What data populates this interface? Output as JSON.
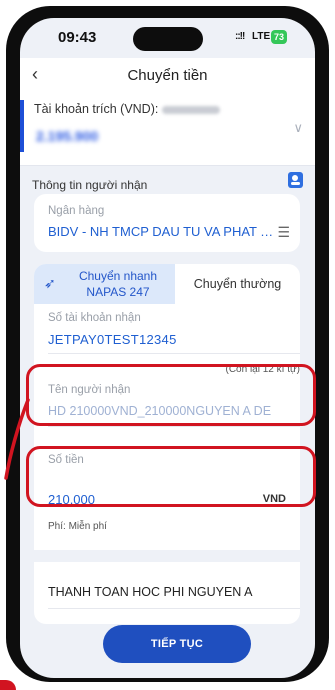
{
  "status_bar": {
    "time": "09:43",
    "signal": "::!!",
    "network": "LTE",
    "battery": "73"
  },
  "nav": {
    "back_icon": "chevron-left-icon",
    "title": "Chuyển tiền"
  },
  "source_account": {
    "label": "Tài khoản trích (VND):",
    "number_masked": "",
    "balance_blurred": "2.195.900"
  },
  "recipient_section": {
    "title": "Thông tin người nhận",
    "contacts_icon": "contact-book-icon"
  },
  "bank": {
    "label": "Ngân hàng",
    "value": "BIDV - NH TMCP DAU TU VA PHAT TRIEN VIET NAM",
    "list_icon": "list-icon"
  },
  "tabs": [
    {
      "line1": "Chuyển nhanh",
      "line2": "NAPAS 247",
      "icon": "rocket-icon",
      "active": true
    },
    {
      "label": "Chuyển thường",
      "active": false
    }
  ],
  "account_number": {
    "label": "Số tài khoản nhận",
    "value": "JETPAY0TEST12345",
    "remaining": "(Còn lại 12 kí tự)"
  },
  "recipient_name": {
    "label": "Tên người nhận",
    "value": "HD 210000VND_210000NGUYEN A DE"
  },
  "amount": {
    "label": "Số tiền",
    "value": "210.000",
    "unit": "VND"
  },
  "fee": {
    "label": "Phí:",
    "value": "Miễn phí"
  },
  "content": {
    "value": "THANH TOAN HOC PHI NGUYEN A"
  },
  "cta": {
    "label": "TIẾP TỤC"
  },
  "colors": {
    "accent": "#1f5fd1",
    "highlight": "#d11420",
    "cta": "#1f4fbf"
  }
}
